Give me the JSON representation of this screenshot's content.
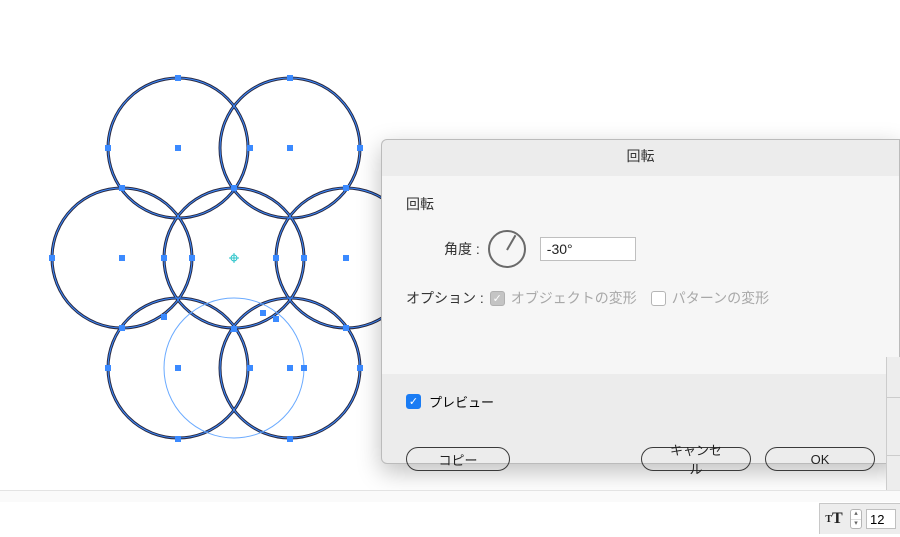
{
  "dialog": {
    "title": "回転",
    "section_label": "回転",
    "angle_label": "角度 :",
    "angle_value": "-30°",
    "angle_dial_rotation": -60,
    "options_label": "オプション :",
    "transform_objects_label": "オブジェクトの変形",
    "transform_objects_checked": true,
    "transform_patterns_label": "パターンの変形",
    "transform_patterns_checked": false,
    "preview_label": "プレビュー",
    "preview_checked": true,
    "copy_button": "コピー",
    "cancel_button": "キャンセル",
    "ok_button": "OK"
  },
  "footer": {
    "font_size_value": "12"
  },
  "colors": {
    "selection": "#3b8aff",
    "stroke": "#2a2a42",
    "dialog_bg": "#ececec",
    "dialog_body": "#f6f6f6",
    "accent": "#1a7cf4"
  }
}
